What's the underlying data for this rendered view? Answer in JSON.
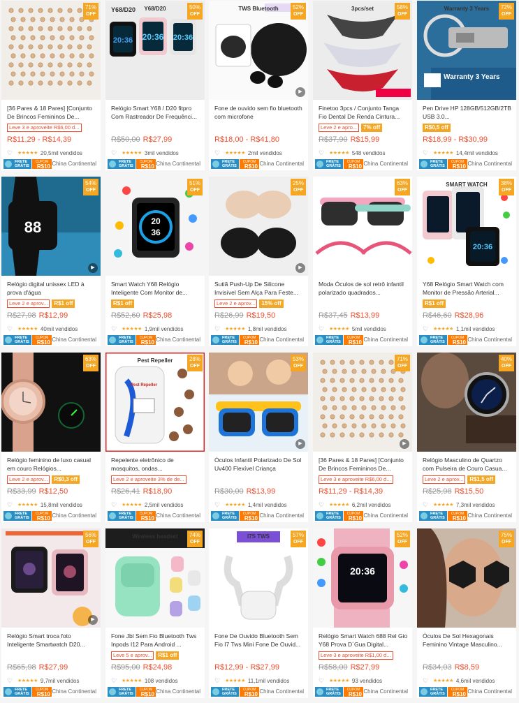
{
  "badges": {
    "free_shipping": "FRETE GRÁTIS",
    "coupon": "CUPOM",
    "coupon_value": "R$10"
  },
  "colors": {
    "accent": "#ee4d2d",
    "discount_badge": "#f5a623",
    "free_shipping": "#2a8ec4",
    "coupon": "#ff7a00"
  },
  "products": [
    {
      "discount": "71%",
      "off": "OFF",
      "image_text": "",
      "title": "[36 Pares & 18 Pares] [Conjunto De Brincos Femininos De...",
      "promo": "Leve 3 e aproveite R$6,00 d...",
      "promo_tag": "",
      "old_price": "",
      "price": "R$11,29 - R$14,39",
      "sold": "20,5mil vendidos",
      "location": "China Continental",
      "video": false,
      "img": "earrings"
    },
    {
      "discount": "50%",
      "off": "OFF",
      "image_text": "Y68/D20",
      "title": "Relógio Smart Y68 / D20 fitpro Com Rastreador De Frequênci...",
      "promo": "",
      "promo_tag": "",
      "old_price": "R$50,00",
      "price": "R$27,99",
      "sold": "3mil vendidos",
      "location": "China Continental",
      "video": false,
      "img": "watches-color"
    },
    {
      "discount": "52%",
      "off": "OFF",
      "image_text": "TWS Bluetooth",
      "title": "Fone de ouvido sem fio bluetooth com microfone",
      "promo": "",
      "promo_tag": "",
      "old_price": "",
      "price": "R$18,00 - R$41,80",
      "sold": "2mil vendidos",
      "location": "China Continental",
      "video": true,
      "img": "earbuds-black"
    },
    {
      "discount": "58%",
      "off": "OFF",
      "image_text": "3pcs/set",
      "title": "Finetoo 3pcs / Conjunto Tanga Fio Dental De Renda Cintura...",
      "promo": "Leve 2 e apro...",
      "promo_tag": "7% off",
      "old_price": "R$37,90",
      "price": "R$15,99",
      "sold": "548 vendidos",
      "location": "China Continental",
      "video": false,
      "img": "lingerie"
    },
    {
      "discount": "72%",
      "off": "OFF",
      "image_text": "Warranty 3 Years",
      "title": "Pen Drive HP 128GB/512GB/2TB USB 3.0...",
      "promo": "",
      "promo_tag": "R$0,5 off",
      "old_price": "",
      "price": "R$18,99 - R$30,99",
      "sold": "14,4mil vendidos",
      "location": "China Continental",
      "video": false,
      "img": "pendrive"
    },
    {
      "discount": "54%",
      "off": "OFF",
      "image_text": "",
      "title": "Relógio digital unissex LED à prova d'água",
      "promo": "Leve 2 e aprov...",
      "promo_tag": "R$1 off",
      "old_price": "R$27,98",
      "price": "R$12,99",
      "sold": "40mil vendidos",
      "location": "China Continental",
      "video": true,
      "img": "led-watch"
    },
    {
      "discount": "51%",
      "off": "OFF",
      "image_text": "",
      "title": "Smart Watch Y68 Relógio Inteligente Com Monitor de...",
      "promo": "",
      "promo_tag": "R$1 off",
      "old_price": "R$52,60",
      "price": "R$25,98",
      "sold": "1,9mil vendidos",
      "location": "China Continental",
      "video": false,
      "img": "smartwatch-black"
    },
    {
      "discount": "25%",
      "off": "OFF",
      "image_text": "",
      "title": "Sutiã Push-Up De Silicone Invisível Sem Alça Para Feste...",
      "promo": "Leve 2 e aprov...",
      "promo_tag": "15% off",
      "old_price": "R$26,99",
      "price": "R$19,50",
      "sold": "1,8mil vendidos",
      "location": "China Continental",
      "video": true,
      "img": "bra"
    },
    {
      "discount": "63%",
      "off": "OFF",
      "image_text": "",
      "title": "Moda Óculos de sol retrô infantil polarizado quadrados...",
      "promo": "",
      "promo_tag": "",
      "old_price": "R$37,45",
      "price": "R$13,99",
      "sold": "5mil vendidos",
      "location": "China Continental",
      "video": false,
      "img": "kids-sunglasses-pink"
    },
    {
      "discount": "38%",
      "off": "OFF",
      "image_text": "SMART WATCH",
      "title": "Y68 Relógio Smart Watch com Monitor de Pressão Arterial...",
      "promo": "",
      "promo_tag": "R$1 off",
      "old_price": "R$46,60",
      "price": "R$28,96",
      "sold": "1,1mil vendidos",
      "location": "China Continental",
      "video": false,
      "img": "watches-pink"
    },
    {
      "discount": "63%",
      "off": "OFF",
      "image_text": "",
      "title": "Relógio feminino de luxo casual em couro Relógios...",
      "promo": "Leve 2 e aprov...",
      "promo_tag": "R$0,3 off",
      "old_price": "R$33,99",
      "price": "R$12,50",
      "sold": "15,8mil vendidos",
      "location": "China Continental",
      "video": false,
      "img": "rose-watch"
    },
    {
      "discount": "28%",
      "off": "OFF",
      "image_text": "Pest Repeller",
      "title": "Repelente eletrônico de mosquitos, ondas...",
      "promo": "Leve 2 e aproveite 3% de de...",
      "promo_tag": "",
      "old_price": "R$26,41",
      "price": "R$18,90",
      "sold": "2,5mil vendidos",
      "location": "China Continental",
      "video": false,
      "img": "repeller"
    },
    {
      "discount": "53%",
      "off": "OFF",
      "image_text": "",
      "title": "Óculos Infantil Polarizado De Sol Uv400 Flexível Criança",
      "promo": "",
      "promo_tag": "",
      "old_price": "R$30,00",
      "price": "R$13,99",
      "sold": "1,4mil vendidos",
      "location": "China Continental",
      "video": true,
      "img": "kids-sunglasses-blue"
    },
    {
      "discount": "71%",
      "off": "OFF",
      "image_text": "",
      "title": "[36 Pares & 18 Pares] [Conjunto De Brincos Femininos De...",
      "promo": "Leve 3 e aproveite R$6,00 d...",
      "promo_tag": "",
      "old_price": "",
      "price": "R$11,29 - R$14,39",
      "sold": "6,2mil vendidos",
      "location": "China Continental",
      "video": true,
      "img": "earrings"
    },
    {
      "discount": "40%",
      "off": "OFF",
      "image_text": "",
      "title": "Relógio Masculino de Quartzo com Pulseira de Couro Casua...",
      "promo": "Leve 2 e aprov...",
      "promo_tag": "R$1,5 off",
      "old_price": "R$25,98",
      "price": "R$15,50",
      "sold": "7,3mil vendidos",
      "location": "China Continental",
      "video": false,
      "img": "man-watch"
    },
    {
      "discount": "56%",
      "off": "OFF",
      "image_text": "",
      "title": "Relógio Smart troca foto Inteligente Smartwatch D20...",
      "promo": "",
      "promo_tag": "",
      "old_price": "R$65,98",
      "price": "R$27,99",
      "sold": "9,7mil vendidos",
      "location": "China Continental",
      "video": true,
      "img": "photo-watches"
    },
    {
      "discount": "74%",
      "off": "OFF",
      "image_text": "Wireless headset",
      "title": "Fone Jbl Sem Fio Bluetooth Tws Inpods I12 Para Android ...",
      "promo": "Leve 5 e aprov...",
      "promo_tag": "R$1 off",
      "old_price": "R$95,00",
      "price": "R$24,98",
      "sold": "108 vendidos",
      "location": "China Continental",
      "video": false,
      "img": "green-earbuds"
    },
    {
      "discount": "57%",
      "off": "OFF",
      "image_text": "I7S TWS",
      "title": "Fone De Ouvido Bluetooth Sem Fio I7 Tws Mini Fone De Ouvid...",
      "promo": "",
      "promo_tag": "",
      "old_price": "",
      "price": "R$12,99 - R$27,99",
      "sold": "11,1mil vendidos",
      "location": "China Continental",
      "video": false,
      "img": "white-earbuds"
    },
    {
      "discount": "52%",
      "off": "OFF",
      "image_text": "",
      "title": "Relógio Smart Watch 688 Rel Gio Y68 Prova D´Gua Digital...",
      "promo": "Leve 3 e aproveite R$1,00 d...",
      "promo_tag": "",
      "old_price": "R$58,00",
      "price": "R$27,99",
      "sold": "93 vendidos",
      "location": "China Continental",
      "video": false,
      "img": "pink-smartwatch"
    },
    {
      "discount": "75%",
      "off": "OFF",
      "image_text": "",
      "title": "Óculos De Sol Hexagonais Feminino Vintage Masculino...",
      "promo": "",
      "promo_tag": "",
      "old_price": "R$34,03",
      "price": "R$8,59",
      "sold": "4,6mil vendidos",
      "location": "China Continental",
      "video": false,
      "img": "woman-sunglasses"
    }
  ]
}
